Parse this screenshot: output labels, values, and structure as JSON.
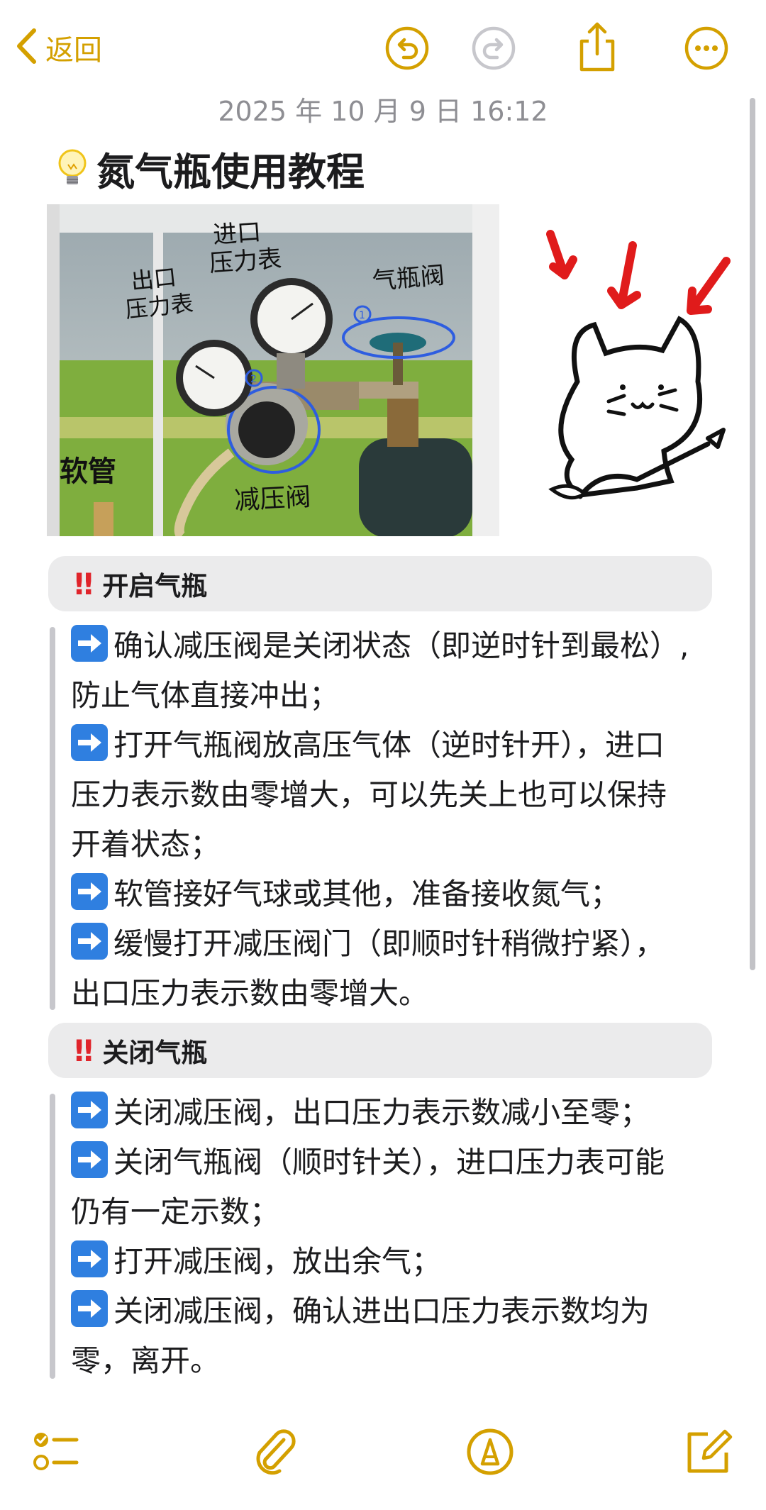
{
  "nav": {
    "back_label": "返回"
  },
  "note": {
    "date": "2025 年 10 月 9 日 16:12",
    "title": "氮气瓶使用教程"
  },
  "photo_annotations": {
    "inlet_gauge": "进口\n压力表",
    "outlet_gauge": "出口\n压力表",
    "bottle_valve": "气瓶阀",
    "hose": "软管",
    "reducer_valve": "减压阀"
  },
  "sections": [
    {
      "header": "开启气瓶",
      "lines": [
        {
          "arrow": true,
          "text": "确认减压阀是关闭状态（即逆时针到最松）,"
        },
        {
          "arrow": false,
          "text": "防止气体直接冲出；"
        },
        {
          "arrow": true,
          "text": "打开气瓶阀放高压气体（逆时针开），进口"
        },
        {
          "arrow": false,
          "text": "压力表示数由零增大，可以先关上也可以保持"
        },
        {
          "arrow": false,
          "text": "开着状态；"
        },
        {
          "arrow": true,
          "text": "软管接好气球或其他，准备接收氮气；"
        },
        {
          "arrow": true,
          "text": "缓慢打开减压阀门（即顺时针稍微拧紧），"
        },
        {
          "arrow": false,
          "text": "出口压力表示数由零增大。"
        }
      ]
    },
    {
      "header": "关闭气瓶",
      "lines": [
        {
          "arrow": true,
          "text": "关闭减压阀，出口压力表示数减小至零；"
        },
        {
          "arrow": true,
          "text": "关闭气瓶阀（顺时针关），进口压力表可能"
        },
        {
          "arrow": false,
          "text": "仍有一定示数；"
        },
        {
          "arrow": true,
          "text": "打开减压阀，放出余气；"
        },
        {
          "arrow": true,
          "text": "关闭减压阀，确认进出口压力表示数均为"
        },
        {
          "arrow": false,
          "text": "零，离开。"
        }
      ]
    }
  ],
  "icons": {
    "back": "chevron-left-icon",
    "undo": "undo-icon",
    "redo": "redo-icon",
    "share": "share-icon",
    "more": "more-icon",
    "bulb": "lightbulb-icon",
    "arrow": "right-arrow-emoji-icon",
    "bang": "double-exclamation-icon",
    "checklist": "checklist-icon",
    "attach": "paperclip-icon",
    "markup": "markup-pen-icon",
    "compose": "compose-icon"
  },
  "colors": {
    "accent": "#d4a000",
    "arrow_bg": "#2f7fe0",
    "bang": "#e0242b",
    "header_bg": "#ebebec"
  }
}
